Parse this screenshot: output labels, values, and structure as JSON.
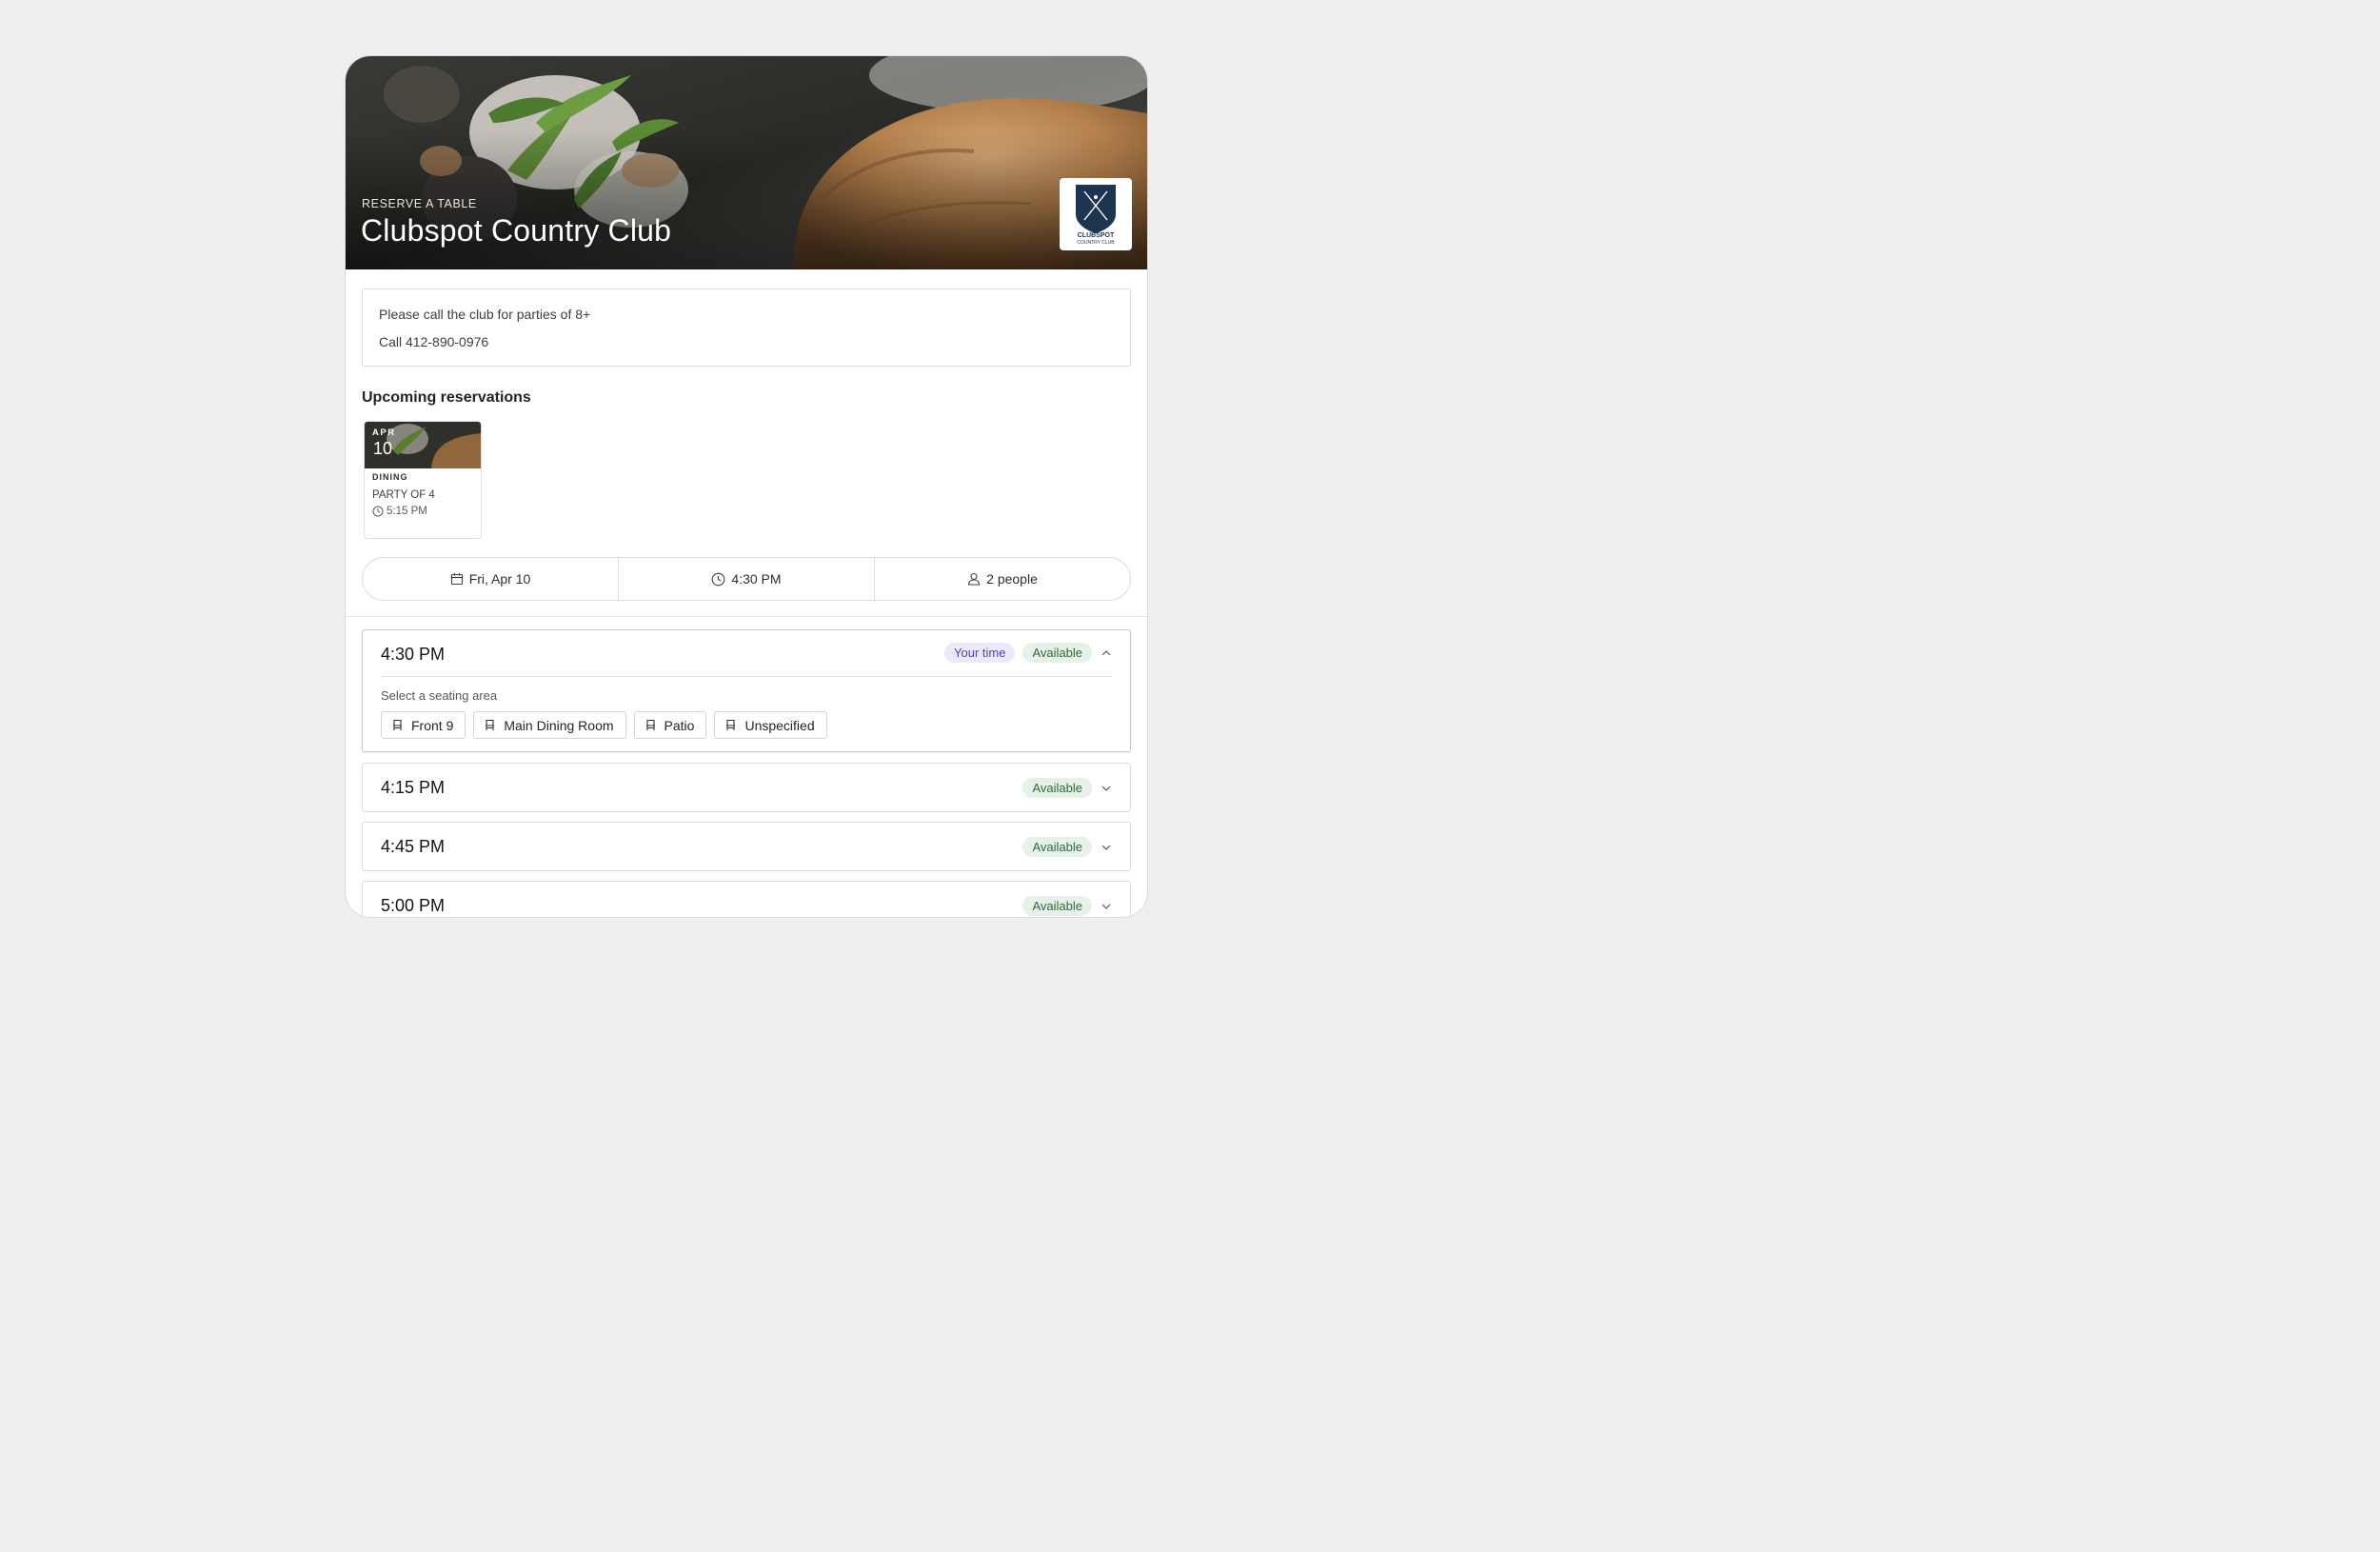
{
  "hero": {
    "kicker": "RESERVE A TABLE",
    "title": "Clubspot Country Club",
    "logo_text": "CLUBSPOT COUNTRY CLUB"
  },
  "notice": {
    "line1": "Please call the club for parties of 8+",
    "line2": "Call 412-890-0976"
  },
  "upcoming": {
    "title": "Upcoming reservations",
    "items": [
      {
        "month": "APR",
        "day": "10",
        "type": "DINING",
        "party": "PARTY OF 4",
        "time": "5:15 PM"
      }
    ]
  },
  "filters": {
    "date": "Fri, Apr 10",
    "time": "4:30 PM",
    "party": "2 people"
  },
  "slots": [
    {
      "time": "4:30 PM",
      "mine_label": "Your time",
      "status": "Available",
      "expanded": true,
      "seating_label": "Select a seating area",
      "areas": [
        "Front 9",
        "Main Dining Room",
        "Patio",
        "Unspecified"
      ]
    },
    {
      "time": "4:15 PM",
      "status": "Available",
      "expanded": false
    },
    {
      "time": "4:45 PM",
      "status": "Available",
      "expanded": false
    },
    {
      "time": "5:00 PM",
      "status": "Available",
      "expanded": false
    }
  ],
  "colors": {
    "available_bg": "#e6f1e8",
    "available_text": "#2e6b3d",
    "your_time_bg": "#ebe9fb",
    "your_time_text": "#4b3fc4",
    "logo_navy": "#1d3550"
  },
  "icons": {
    "date": "calendar-icon",
    "time": "clock-icon",
    "party": "person-icon",
    "seat": "chair-icon",
    "expand": "chevron-down-icon",
    "collapse": "chevron-up-icon"
  }
}
